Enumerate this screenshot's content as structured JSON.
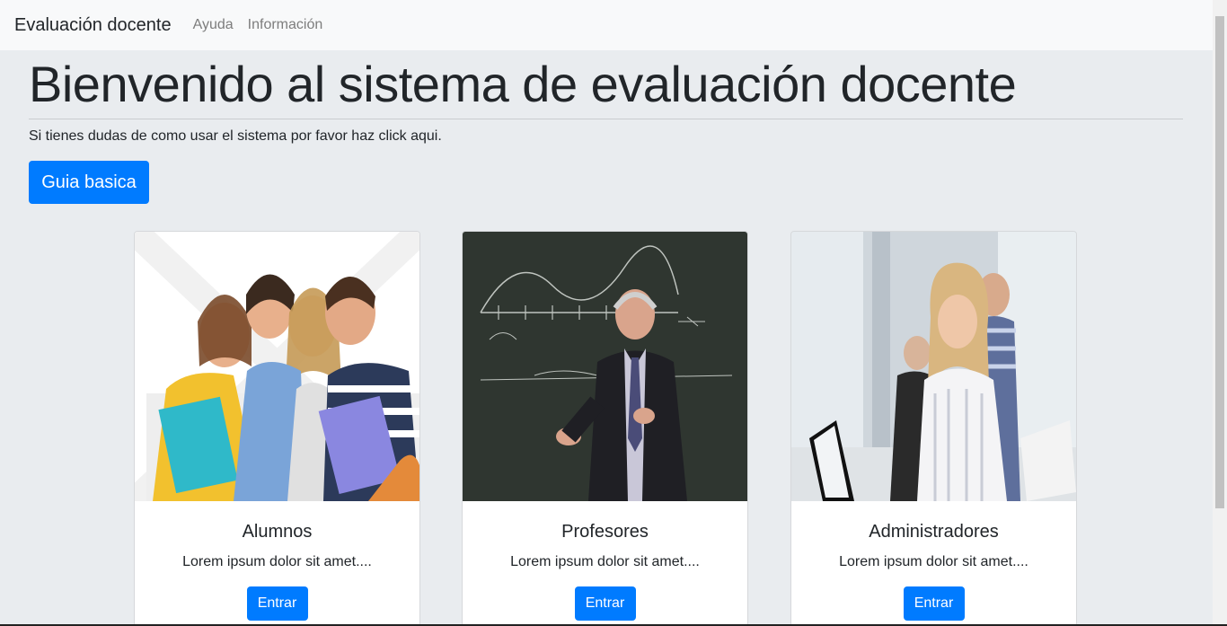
{
  "navbar": {
    "brand": "Evaluación docente",
    "links": [
      "Ayuda",
      "Información"
    ]
  },
  "jumbotron": {
    "title": "Bienvenido al sistema de evaluación docente",
    "lead": "Si tienes dudas de como usar el sistema por favor haz click aqui.",
    "button": "Guia basica"
  },
  "cards": [
    {
      "title": "Alumnos",
      "text": "Lorem ipsum dolor sit amet....",
      "button": "Entrar"
    },
    {
      "title": "Profesores",
      "text": "Lorem ipsum dolor sit amet....",
      "button": "Entrar"
    },
    {
      "title": "Administradores",
      "text": "Lorem ipsum dolor sit amet....",
      "button": "Entrar"
    }
  ],
  "colors": {
    "primary": "#007bff",
    "background": "#e9ecef",
    "navbar": "#f8f9fa"
  }
}
